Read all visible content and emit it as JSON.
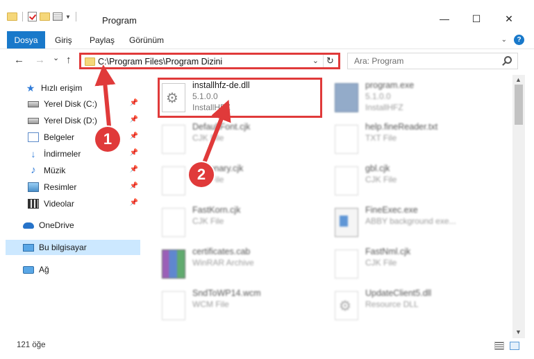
{
  "window": {
    "title": "Program",
    "minimize": "—",
    "maximize": "☐",
    "close": "✕"
  },
  "ribbon": {
    "tabs": [
      "Dosya",
      "Giriş",
      "Paylaş",
      "Görünüm"
    ],
    "help": "?"
  },
  "navigation": {
    "back": "←",
    "forward": "→",
    "recent": "⌄",
    "up": "↑",
    "address": "C:\\Program Files\\Program Dizini",
    "refresh": "↻"
  },
  "search": {
    "placeholder": "Ara: Program"
  },
  "sidebar": {
    "items": [
      {
        "label": "Hızlı erişim",
        "icon": "star-icon",
        "pinned": false
      },
      {
        "label": "Yerel Disk (C:)",
        "icon": "drive-icon",
        "pinned": true
      },
      {
        "label": "Yerel Disk (D:)",
        "icon": "drive-icon",
        "pinned": true
      },
      {
        "label": "Belgeler",
        "icon": "documents-icon",
        "pinned": true
      },
      {
        "label": "İndirmeler",
        "icon": "download-icon",
        "pinned": true
      },
      {
        "label": "Müzik",
        "icon": "music-icon",
        "pinned": true
      },
      {
        "label": "Resimler",
        "icon": "pictures-icon",
        "pinned": true
      },
      {
        "label": "Videolar",
        "icon": "videos-icon",
        "pinned": true
      },
      {
        "label": "OneDrive",
        "icon": "onedrive-icon",
        "pinned": false
      },
      {
        "label": "Bu bilgisayar",
        "icon": "this-pc-icon",
        "pinned": false
      },
      {
        "label": "Ağ",
        "icon": "network-icon",
        "pinned": false
      }
    ]
  },
  "files": [
    {
      "name": "installhfz-de.dll",
      "line1": "5.1.0.0",
      "line2": "InstallHFZ",
      "icon": "dll-icon"
    },
    {
      "name": "program.exe",
      "line1": "5.1.0.0",
      "line2": "InstallHFZ",
      "icon": "exe-icon"
    },
    {
      "name": "DefaultFont.cjk",
      "line1": "CJK File",
      "line2": "",
      "icon": "file-icon"
    },
    {
      "name": "help.fineReader.txt",
      "line1": "TXT File",
      "line2": "",
      "icon": "file-icon"
    },
    {
      "name": "Dictionary.cjk",
      "line1": "CJK File",
      "line2": "",
      "icon": "file-icon"
    },
    {
      "name": "gbl.cjk",
      "line1": "CJK File",
      "line2": "",
      "icon": "file-icon"
    },
    {
      "name": "FastKorn.cjk",
      "line1": "CJK File",
      "line2": "",
      "icon": "file-icon"
    },
    {
      "name": "FineExec.exe",
      "line1": "ABBY background exe...",
      "line2": "",
      "icon": "app-icon"
    },
    {
      "name": "certificates.cab",
      "line1": "WinRAR Archive",
      "line2": "",
      "icon": "archive-icon"
    },
    {
      "name": "FastNml.cjk",
      "line1": "CJK File",
      "line2": "",
      "icon": "file-icon"
    },
    {
      "name": "SndToWP14.wcm",
      "line1": "WCM File",
      "line2": "",
      "icon": "file-icon"
    },
    {
      "name": "UpdateClient5.dll",
      "line1": "Resource DLL",
      "line2": "",
      "icon": "dll-icon"
    }
  ],
  "status": {
    "item_count": "121 öğe"
  },
  "annotations": {
    "callout1": "1",
    "callout2": "2",
    "color": "#e03a3a"
  },
  "colors": {
    "accent": "#1979ca",
    "selection": "#cce8ff"
  }
}
